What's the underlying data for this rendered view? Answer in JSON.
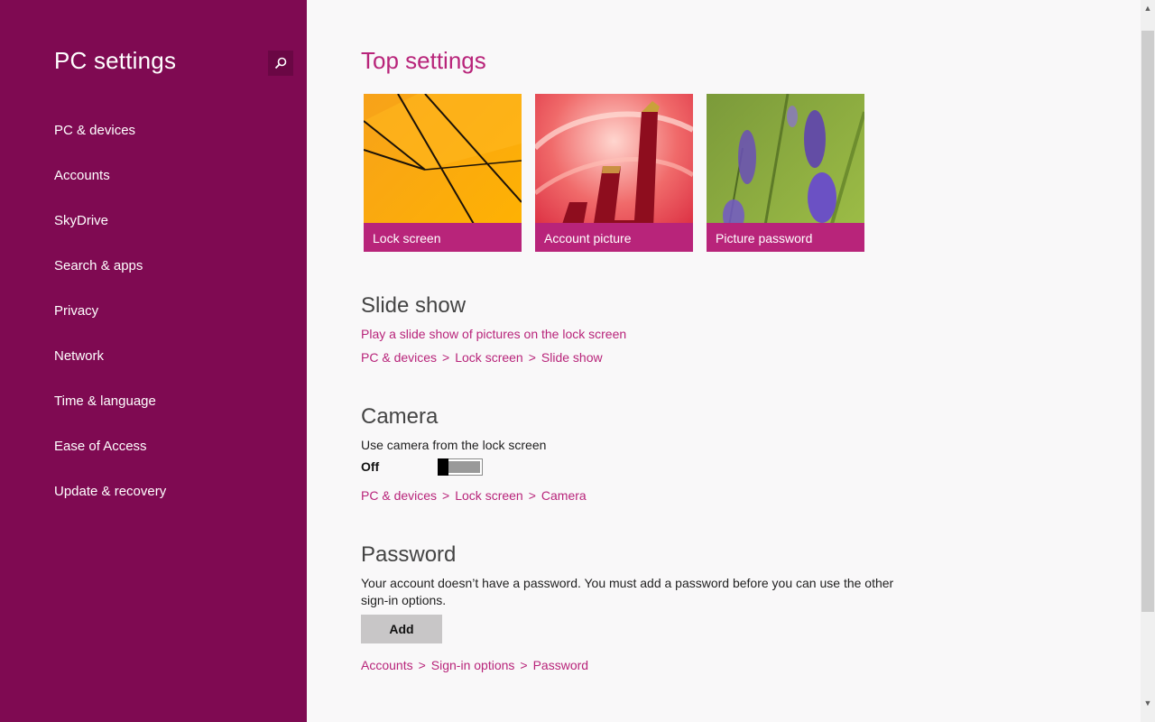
{
  "sidebar": {
    "title": "PC settings",
    "search_icon": "search-icon",
    "items": [
      {
        "label": "PC & devices"
      },
      {
        "label": "Accounts"
      },
      {
        "label": "SkyDrive"
      },
      {
        "label": "Search & apps"
      },
      {
        "label": "Privacy"
      },
      {
        "label": "Network"
      },
      {
        "label": "Time & language"
      },
      {
        "label": "Ease of Access"
      },
      {
        "label": "Update & recovery"
      }
    ]
  },
  "main": {
    "title": "Top settings",
    "tiles": [
      {
        "label": "Lock screen"
      },
      {
        "label": "Account picture"
      },
      {
        "label": "Picture password"
      }
    ],
    "slideshow": {
      "heading": "Slide show",
      "link": "Play a slide show of pictures on the lock screen",
      "breadcrumb": [
        "PC & devices",
        "Lock screen",
        "Slide show"
      ]
    },
    "camera": {
      "heading": "Camera",
      "description": "Use camera from the lock screen",
      "toggle_state": "Off",
      "toggle_on": false,
      "breadcrumb": [
        "PC & devices",
        "Lock screen",
        "Camera"
      ]
    },
    "password": {
      "heading": "Password",
      "description": "Your account doesn’t have a password. You must add a password before you can use the other sign-in options.",
      "button_label": "Add",
      "breadcrumb": [
        "Accounts",
        "Sign-in options",
        "Password"
      ]
    }
  },
  "breadcrumb_separator": ">",
  "colors": {
    "sidebar_bg": "#7f0a52",
    "accent": "#b8247a",
    "content_bg": "#f9f8f9"
  }
}
